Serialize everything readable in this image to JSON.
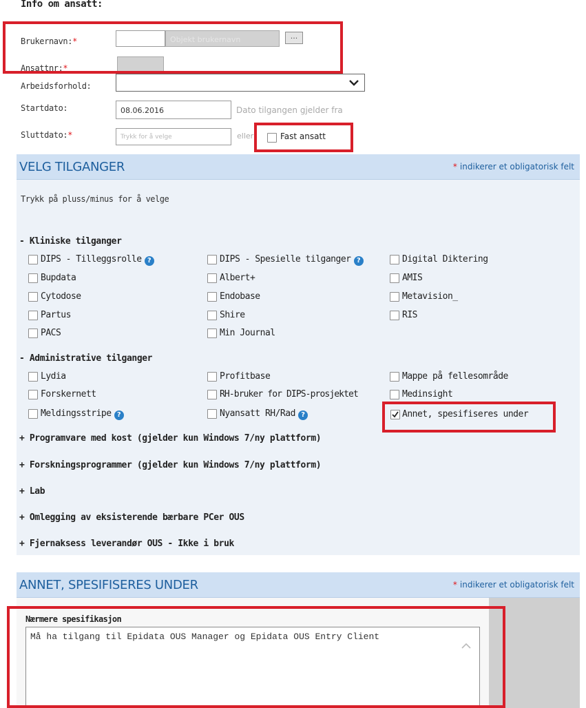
{
  "employee": {
    "section_title": "Info om ansatt:",
    "username_label": "Brukernavn:",
    "username_placeholder": "Objekt brukernavn",
    "browse_button": "...",
    "employee_no_label": "Ansattnr:",
    "employment_label": "Arbeidsforhold:",
    "start_label": "Startdato:",
    "start_value": "08.06.2016",
    "start_hint": "Dato tilgangen gjelder fra",
    "end_label": "Sluttdato:",
    "end_placeholder": "Trykk for å velge",
    "or_text": "eller",
    "permanent_label": "Fast ansatt",
    "required_mark": "*"
  },
  "access_header": {
    "title": "VELG TILGANGER",
    "note": "indikerer et obligatorisk felt",
    "star": "*"
  },
  "instructions": "Trykk på pluss/minus for å velge",
  "clinical": {
    "title": "- Kliniske tilganger",
    "items": [
      {
        "label": "DIPS - Tilleggsrolle",
        "checked": false
      },
      {
        "label": "DIPS - Spesielle tilganger",
        "checked": false
      },
      {
        "label": "Digital Diktering",
        "checked": false
      },
      {
        "label": "Bupdata",
        "checked": false
      },
      {
        "label": "Albert+",
        "checked": false
      },
      {
        "label": "AMIS",
        "checked": false
      },
      {
        "label": "Cytodose",
        "checked": false
      },
      {
        "label": "Endobase",
        "checked": false
      },
      {
        "label": "Metavision_",
        "checked": false
      },
      {
        "label": "Partus",
        "checked": false
      },
      {
        "label": "Shire",
        "checked": false
      },
      {
        "label": "RIS",
        "checked": false
      },
      {
        "label": "PACS",
        "checked": false
      },
      {
        "label": "Min Journal",
        "checked": false
      }
    ]
  },
  "administrative": {
    "title": "- Administrative tilganger",
    "items": [
      {
        "label": "Lydia",
        "checked": false
      },
      {
        "label": "Profitbase",
        "checked": false
      },
      {
        "label": "Mappe på fellesområde",
        "checked": false
      },
      {
        "label": "Forskernett",
        "checked": false
      },
      {
        "label": "RH-bruker for DIPS-prosjektet",
        "checked": false
      },
      {
        "label": "Medinsight",
        "checked": false
      },
      {
        "label": "Meldingsstripe",
        "checked": false
      },
      {
        "label": "Nyansatt RH/Rad",
        "checked": false
      },
      {
        "label": "Annet, spesifiseres under",
        "checked": true
      }
    ]
  },
  "expandables": [
    "+ Programvare med kost (gjelder kun Windows 7/ny plattform)",
    "+ Forskningsprogrammer (gjelder kun Windows 7/ny plattform)",
    "+ Lab",
    "+ Omlegging av eksisterende bærbare PCer OUS",
    "+ Fjernaksess leverandør OUS - Ikke i bruk"
  ],
  "other_header": {
    "title": "ANNET, SPESIFISERES UNDER",
    "note": "indikerer et obligatorisk felt",
    "star": "*"
  },
  "specification": {
    "label": "Nærmere spesifikasjon",
    "text": "Må ha tilgang til Epidata OUS Manager og Epidata OUS Entry Client"
  },
  "icons": {
    "help": "question-circle-icon",
    "dropdown": "chevron-down-icon",
    "check": "checkmark-icon"
  },
  "colors": {
    "header_bg": "#cfe0f3",
    "header_text": "#1e5f9e",
    "required": "#e0161a",
    "annotation_red": "#d81f2a"
  }
}
